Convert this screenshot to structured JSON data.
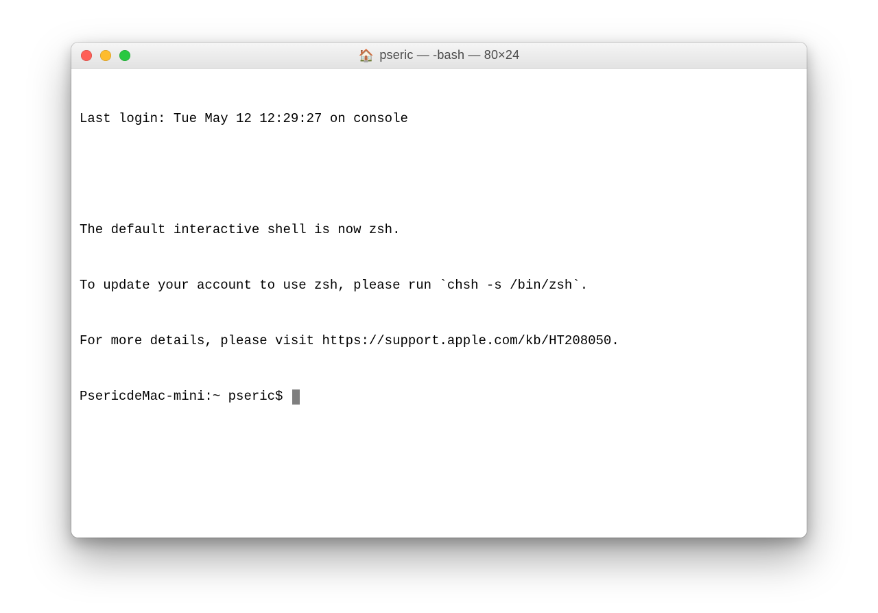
{
  "window": {
    "title": "pseric — -bash — 80×24",
    "icon": "🏠",
    "traffic": {
      "close": "#ff5f57",
      "minimize": "#febc2e",
      "zoom": "#28c840"
    }
  },
  "terminal": {
    "lines": [
      "Last login: Tue May 12 12:29:27 on console",
      "",
      "The default interactive shell is now zsh.",
      "To update your account to use zsh, please run `chsh -s /bin/zsh`.",
      "For more details, please visit https://support.apple.com/kb/HT208050."
    ],
    "prompt": "PsericdeMac-mini:~ pseric$ "
  }
}
